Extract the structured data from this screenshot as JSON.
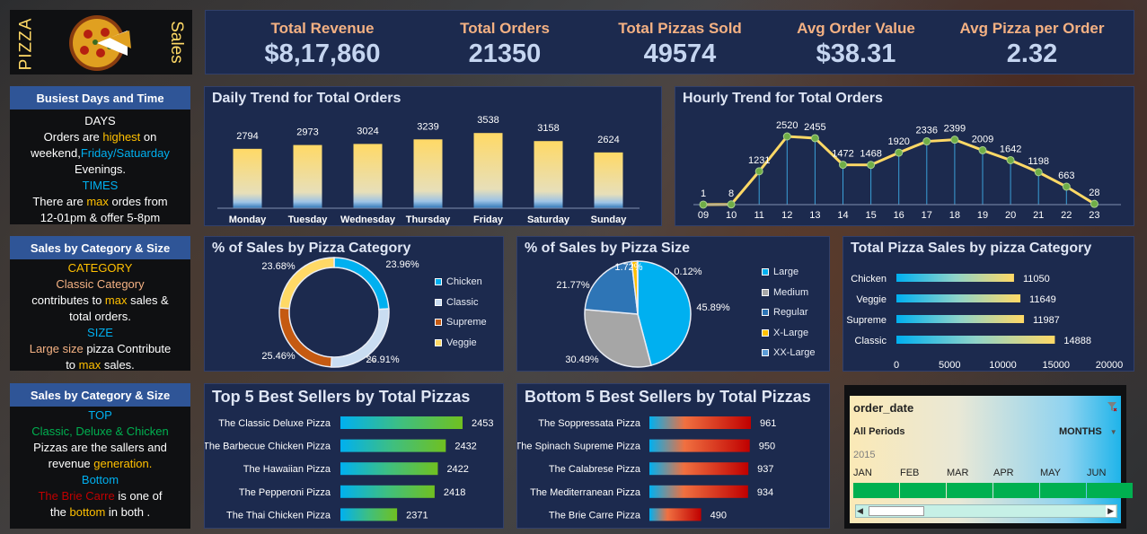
{
  "header": {
    "pizza_label": "PIZZA",
    "sales_label": "Sales"
  },
  "kpis": [
    {
      "label": "Total Revenue",
      "value": "$8,17,860"
    },
    {
      "label": "Total Orders",
      "value": "21350"
    },
    {
      "label": "Total Pizzas Sold",
      "value": "49574"
    },
    {
      "label": "Avg Order Value",
      "value": "$38.31"
    },
    {
      "label": "Avg Pizza per Order",
      "value": "2.32"
    }
  ],
  "insights": {
    "busiest": {
      "title": "Busiest Days and Time",
      "days_head": "DAYS",
      "l1a": "Orders are ",
      "l1b": "highest",
      "l1c": " on",
      "l2a": "weekend,",
      "l2b": "Friday/Satuarday",
      "l3": "Evenings.",
      "times_head": "TIMES",
      "l4a": "There are ",
      "l4b": "max",
      "l4c": " ordes from",
      "l5": "12-01pm & offer 5-8pm"
    },
    "category": {
      "title": "Sales by Category & Size",
      "cat_head": "CATEGORY",
      "l1": "Classic Category",
      "l2a": "contributes to ",
      "l2b": "max",
      "l2c": " sales &",
      "l3": "total orders.",
      "size_head": "SIZE",
      "l4a": "Large size",
      "l4b": " pizza Contribute",
      "l5a": "to ",
      "l5b": "max",
      "l5c": " sales."
    },
    "top": {
      "title": "Sales by Category & Size",
      "top_head": "TOP",
      "l1": "Classic, Deluxe & Chicken",
      "l2": "Pizzas are the sallers and",
      "l3a": "revenue ",
      "l3b": "generation.",
      "bottom_head": "Bottom",
      "l4a": "The Brie Carre",
      "l4b": " is one of",
      "l5a": "the ",
      "l5b": "bottom",
      "l5c": " in both ."
    }
  },
  "colors": {
    "panel": "#1c2a4e",
    "accent": "#f4b183",
    "kpi_value": "#c5d5f0",
    "highlight": "#ffc000",
    "blue": "#00b0f0"
  },
  "chart_data": [
    {
      "id": "daily",
      "type": "bar",
      "title": "Daily Trend for Total Orders",
      "categories": [
        "Monday",
        "Tuesday",
        "Wednesday",
        "Thursday",
        "Friday",
        "Saturday",
        "Sunday"
      ],
      "values": [
        2794,
        2973,
        3024,
        3239,
        3538,
        3158,
        2624
      ]
    },
    {
      "id": "hourly",
      "type": "line",
      "title": "Hourly Trend for Total Orders",
      "x": [
        "09",
        "10",
        "11",
        "12",
        "13",
        "14",
        "15",
        "16",
        "17",
        "18",
        "19",
        "20",
        "21",
        "22",
        "23"
      ],
      "values": [
        1,
        8,
        1231,
        2520,
        2455,
        1472,
        1468,
        1920,
        2336,
        2399,
        2009,
        1642,
        1198,
        663,
        28
      ]
    },
    {
      "id": "category_pie",
      "type": "pie",
      "title": "% of Sales by Pizza Category",
      "labels": [
        "Chicken",
        "Classic",
        "Supreme",
        "Veggie"
      ],
      "values": [
        23.96,
        26.91,
        25.46,
        23.68
      ],
      "value_labels": [
        "23.96%",
        "26.91%",
        "25.46%",
        "23.68%"
      ],
      "colors": [
        "#00b0f0",
        "#c9ddf2",
        "#c55a11",
        "#ffd966"
      ]
    },
    {
      "id": "size_pie",
      "type": "pie",
      "title": "% of Sales by Pizza Size",
      "labels": [
        "Large",
        "Medium",
        "Regular",
        "X-Large",
        "XX-Large"
      ],
      "values": [
        45.89,
        30.49,
        21.77,
        1.72,
        0.12
      ],
      "value_labels": [
        "45.89%",
        "30.49%",
        "21.77%",
        "1.72%",
        "0.12%"
      ],
      "colors": [
        "#00b0f0",
        "#a6a6a6",
        "#2e75b6",
        "#ffc000",
        "#5b9bd5"
      ]
    },
    {
      "id": "category_bar",
      "type": "bar",
      "title": "Total Pizza Sales by pizza Category",
      "categories": [
        "Chicken",
        "Veggie",
        "Supreme",
        "Classic"
      ],
      "values": [
        11050,
        11649,
        11987,
        14888
      ],
      "xlim": [
        0,
        20000
      ],
      "ticks": [
        "0",
        "5000",
        "10000",
        "15000",
        "20000"
      ]
    },
    {
      "id": "top5",
      "type": "bar",
      "title": "Top 5 Best Sellers by Total Pizzas",
      "categories": [
        "The Classic Deluxe Pizza",
        "The Barbecue Chicken Pizza",
        "The Hawaiian Pizza",
        "The Pepperoni Pizza",
        "The Thai Chicken Pizza"
      ],
      "values": [
        2453,
        2432,
        2422,
        2418,
        2371
      ]
    },
    {
      "id": "bottom5",
      "type": "bar",
      "title": "Bottom 5 Best Sellers by Total Pizzas",
      "categories": [
        "The Soppressata Pizza",
        "The Spinach Supreme Pizza",
        "The Calabrese Pizza",
        "The Mediterranean Pizza",
        "The Brie Carre Pizza"
      ],
      "values": [
        961,
        950,
        937,
        934,
        490
      ]
    }
  ],
  "slicer": {
    "title": "order_date",
    "periods_label": "All Periods",
    "level_label": "MONTHS",
    "year": "2015",
    "months": [
      "JAN",
      "FEB",
      "MAR",
      "APR",
      "MAY",
      "JUN"
    ]
  }
}
